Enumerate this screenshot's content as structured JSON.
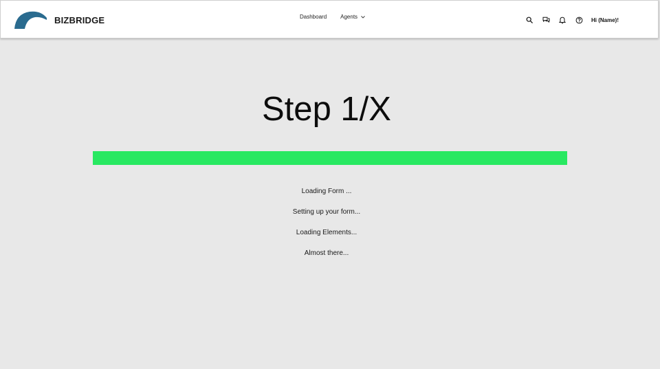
{
  "header": {
    "brand": "BIZBRIDGE",
    "brand_color": "#2a6b8f",
    "logo_icon": "bridge-arch-icon",
    "nav": [
      {
        "label": "Dashboard"
      },
      {
        "label": "Agents",
        "icon": "chevron-down-icon"
      }
    ],
    "actions": {
      "icons": [
        "search-icon",
        "chat-bubbles-icon",
        "bell-icon",
        "help-icon"
      ],
      "greeting": "Hi (Name)!"
    }
  },
  "main": {
    "title": "Step 1/X",
    "progress": {
      "fraction": 1.0,
      "color": "#28e861"
    },
    "messages": [
      "Loading Form ...",
      "Setting up your form...",
      "Loading Elements...",
      "Almost there..."
    ]
  }
}
